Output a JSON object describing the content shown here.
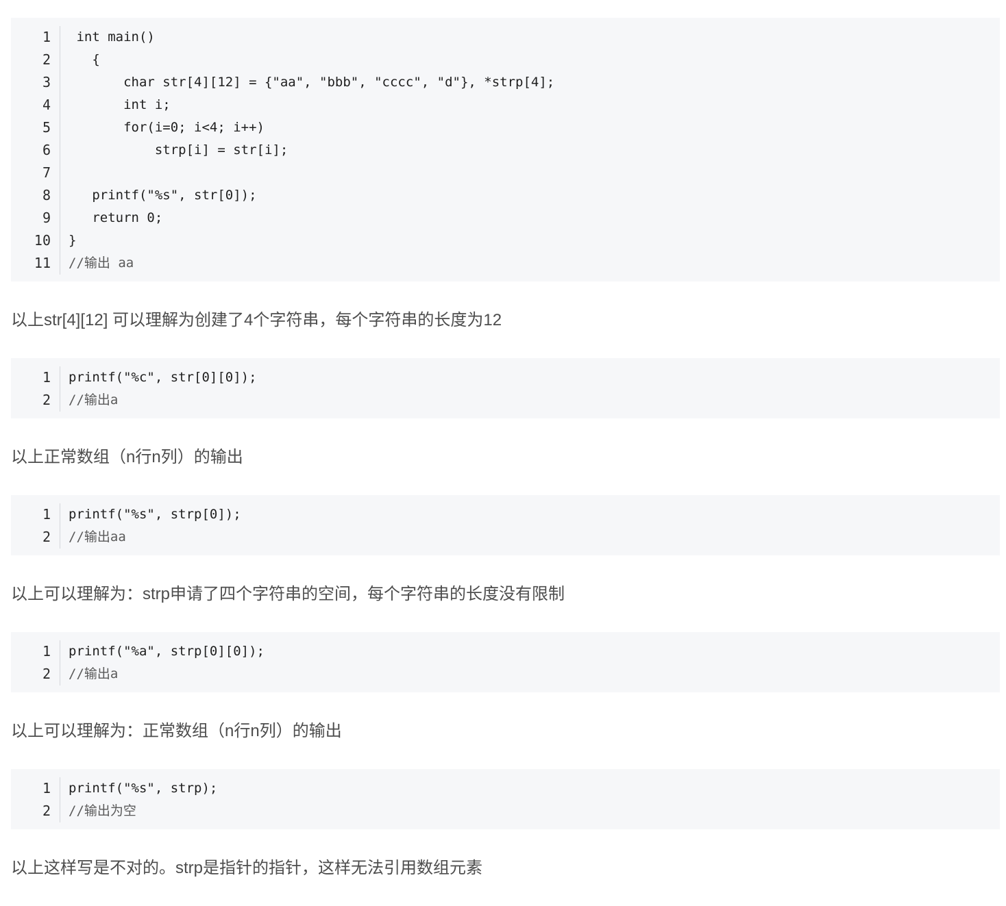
{
  "blocks": [
    {
      "lines": [
        {
          "n": "1",
          "code": " int main()"
        },
        {
          "n": "2",
          "code": "   {"
        },
        {
          "n": "3",
          "code": "       char str[4][12] = {\"aa\", \"bbb\", \"cccc\", \"d\"}, *strp[4];"
        },
        {
          "n": "4",
          "code": "       int i;"
        },
        {
          "n": "5",
          "code": "       for(i=0; i<4; i++)"
        },
        {
          "n": "6",
          "code": "           strp[i] = str[i];"
        },
        {
          "n": "7",
          "code": ""
        },
        {
          "n": "8",
          "code": "   printf(\"%s\", str[0]);"
        },
        {
          "n": "9",
          "code": "   return 0;"
        },
        {
          "n": "10",
          "code": "}"
        },
        {
          "n": "11",
          "code": "//输出 aa"
        }
      ]
    },
    {
      "lines": [
        {
          "n": "1",
          "code": "printf(\"%c\", str[0][0]);"
        },
        {
          "n": "2",
          "code": "//输出a"
        }
      ]
    },
    {
      "lines": [
        {
          "n": "1",
          "code": "printf(\"%s\", strp[0]);"
        },
        {
          "n": "2",
          "code": "//输出aa"
        }
      ]
    },
    {
      "lines": [
        {
          "n": "1",
          "code": "printf(\"%a\", strp[0][0]);"
        },
        {
          "n": "2",
          "code": "//输出a"
        }
      ]
    },
    {
      "lines": [
        {
          "n": "1",
          "code": "printf(\"%s\", strp);"
        },
        {
          "n": "2",
          "code": "//输出为空"
        }
      ]
    }
  ],
  "paragraphs": [
    "以上str[4][12] 可以理解为创建了4个字符串，每个字符串的长度为12",
    "以上正常数组（n行n列）的输出",
    "以上可以理解为：strp申请了四个字符串的空间，每个字符串的长度没有限制",
    "以上可以理解为：正常数组（n行n列）的输出",
    "以上这样写是不对的。strp是指针的指针，这样无法引用数组元素"
  ]
}
